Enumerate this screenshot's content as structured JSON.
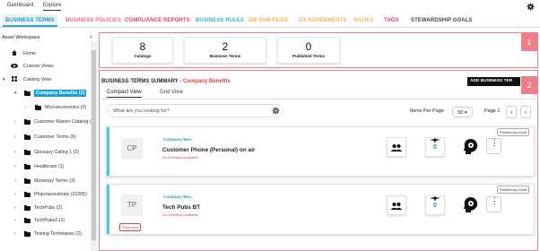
{
  "top_tabs": [
    "Dashboard",
    "Explore"
  ],
  "nav": [
    {
      "label": "BUSINESS TERMS",
      "color": "#2a8fc4"
    },
    {
      "label": "BUSINESS POLICIES",
      "color": "#e86b8a"
    },
    {
      "label": "COMPLIANCE REPORTS",
      "color": "#e04060"
    },
    {
      "label": "BUSINESS RULES",
      "color": "#3ab0c4"
    },
    {
      "label": "DM NSM FILES",
      "color": "#f0b060"
    },
    {
      "label": "DS AGREEMENTS",
      "color": "#f0b060"
    },
    {
      "label": "ISSUES",
      "color": "#f0b060"
    },
    {
      "label": "TAGS",
      "color": "#e04060"
    },
    {
      "label": "STEWARDSHIP GOALS",
      "color": "#444444"
    }
  ],
  "sidebar": {
    "title": "Asset Workspace",
    "items": [
      {
        "label": "Home"
      },
      {
        "label": "Custom Views"
      },
      {
        "label": "Catalog View"
      },
      {
        "label": "Company Benefits (2)"
      },
      {
        "label": "Microeconomics (0)"
      },
      {
        "label": "Customer Master Catalog ("
      },
      {
        "label": "Customer Terms (6)"
      },
      {
        "label": "Glossary Catlog 1 (2)"
      },
      {
        "label": "Healthcare (1)"
      },
      {
        "label": "Monetary Terms (3)"
      },
      {
        "label": "Pharmaceuticals (10205)"
      },
      {
        "label": "TechPubs (2)"
      },
      {
        "label": "TechPubs2 (1)"
      },
      {
        "label": "Testing Techniques (2)"
      }
    ]
  },
  "stats": [
    {
      "value": "8",
      "label": "Catalogs"
    },
    {
      "value": "2",
      "label": "Business Terms"
    },
    {
      "value": "0",
      "label": "Published Terms"
    }
  ],
  "badges": [
    "1",
    "2"
  ],
  "summary": {
    "title": "BUSINESS TERMS SUMMARY - ",
    "catalog": "Company Benefits",
    "add_button": "ADD BUSINESS TER",
    "tabs": [
      "Compact View",
      "Grid View"
    ],
    "search_placeholder": "What are you looking for?",
    "items_per_page_label": "Items Per Page",
    "items_per_page": "50",
    "page_label": "Page 1"
  },
  "cards": [
    {
      "initials": "CP",
      "domain": "Company Ben..",
      "name": "Customer Phone (Personal) on air",
      "nodef": "No Definition available",
      "status": "Preliminary Draft",
      "count": "0",
      "restricted": ""
    },
    {
      "initials": "TP",
      "domain": "Company Ben..",
      "name": "Tech Pubs BT",
      "nodef": "No Definition available",
      "status": "Preliminary Draft",
      "count": "0",
      "restricted": "Restricted"
    }
  ]
}
